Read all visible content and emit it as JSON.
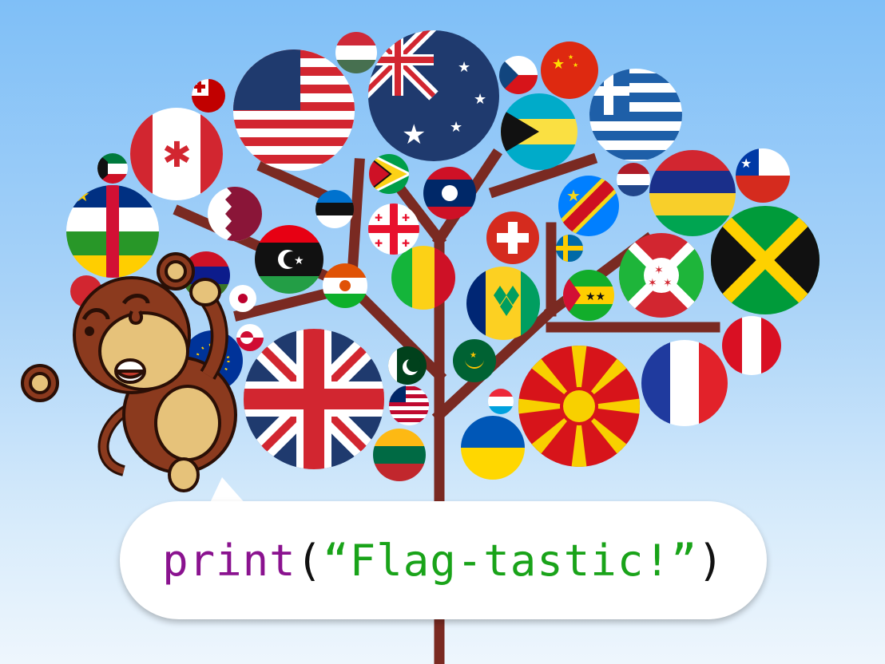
{
  "speech_bubble": {
    "code_function": "print",
    "open_paren": "(",
    "string_literal": "“Flag-tastic!”",
    "close_paren": ")"
  },
  "colors": {
    "sky_top": "#7fbff7",
    "sky_bottom": "#eef6fd",
    "tree_branch": "#7a2a22",
    "code_keyword": "#8a128f",
    "code_string": "#19a319",
    "monkey_body": "#8b3a1e",
    "monkey_face": "#e6c27a"
  },
  "flags": [
    "usa",
    "australia",
    "canada",
    "united-kingdom",
    "north-macedonia",
    "jamaica",
    "greece",
    "france",
    "mauritius",
    "burundi",
    "bahamas",
    "central-african-republic",
    "china",
    "czech-republic",
    "hungary",
    "tonga",
    "kuwait",
    "qatar",
    "libya",
    "niger",
    "mali",
    "switzerland",
    "saint-vincent",
    "dr-congo",
    "chile",
    "peru",
    "guyana",
    "laos",
    "georgia",
    "estonia",
    "netherlands",
    "sweden",
    "sao-tome",
    "pakistan",
    "mauritania",
    "liberia",
    "lithuania",
    "ukraine",
    "luxembourg",
    "greenland",
    "japan",
    "european-union",
    "gambia"
  ]
}
